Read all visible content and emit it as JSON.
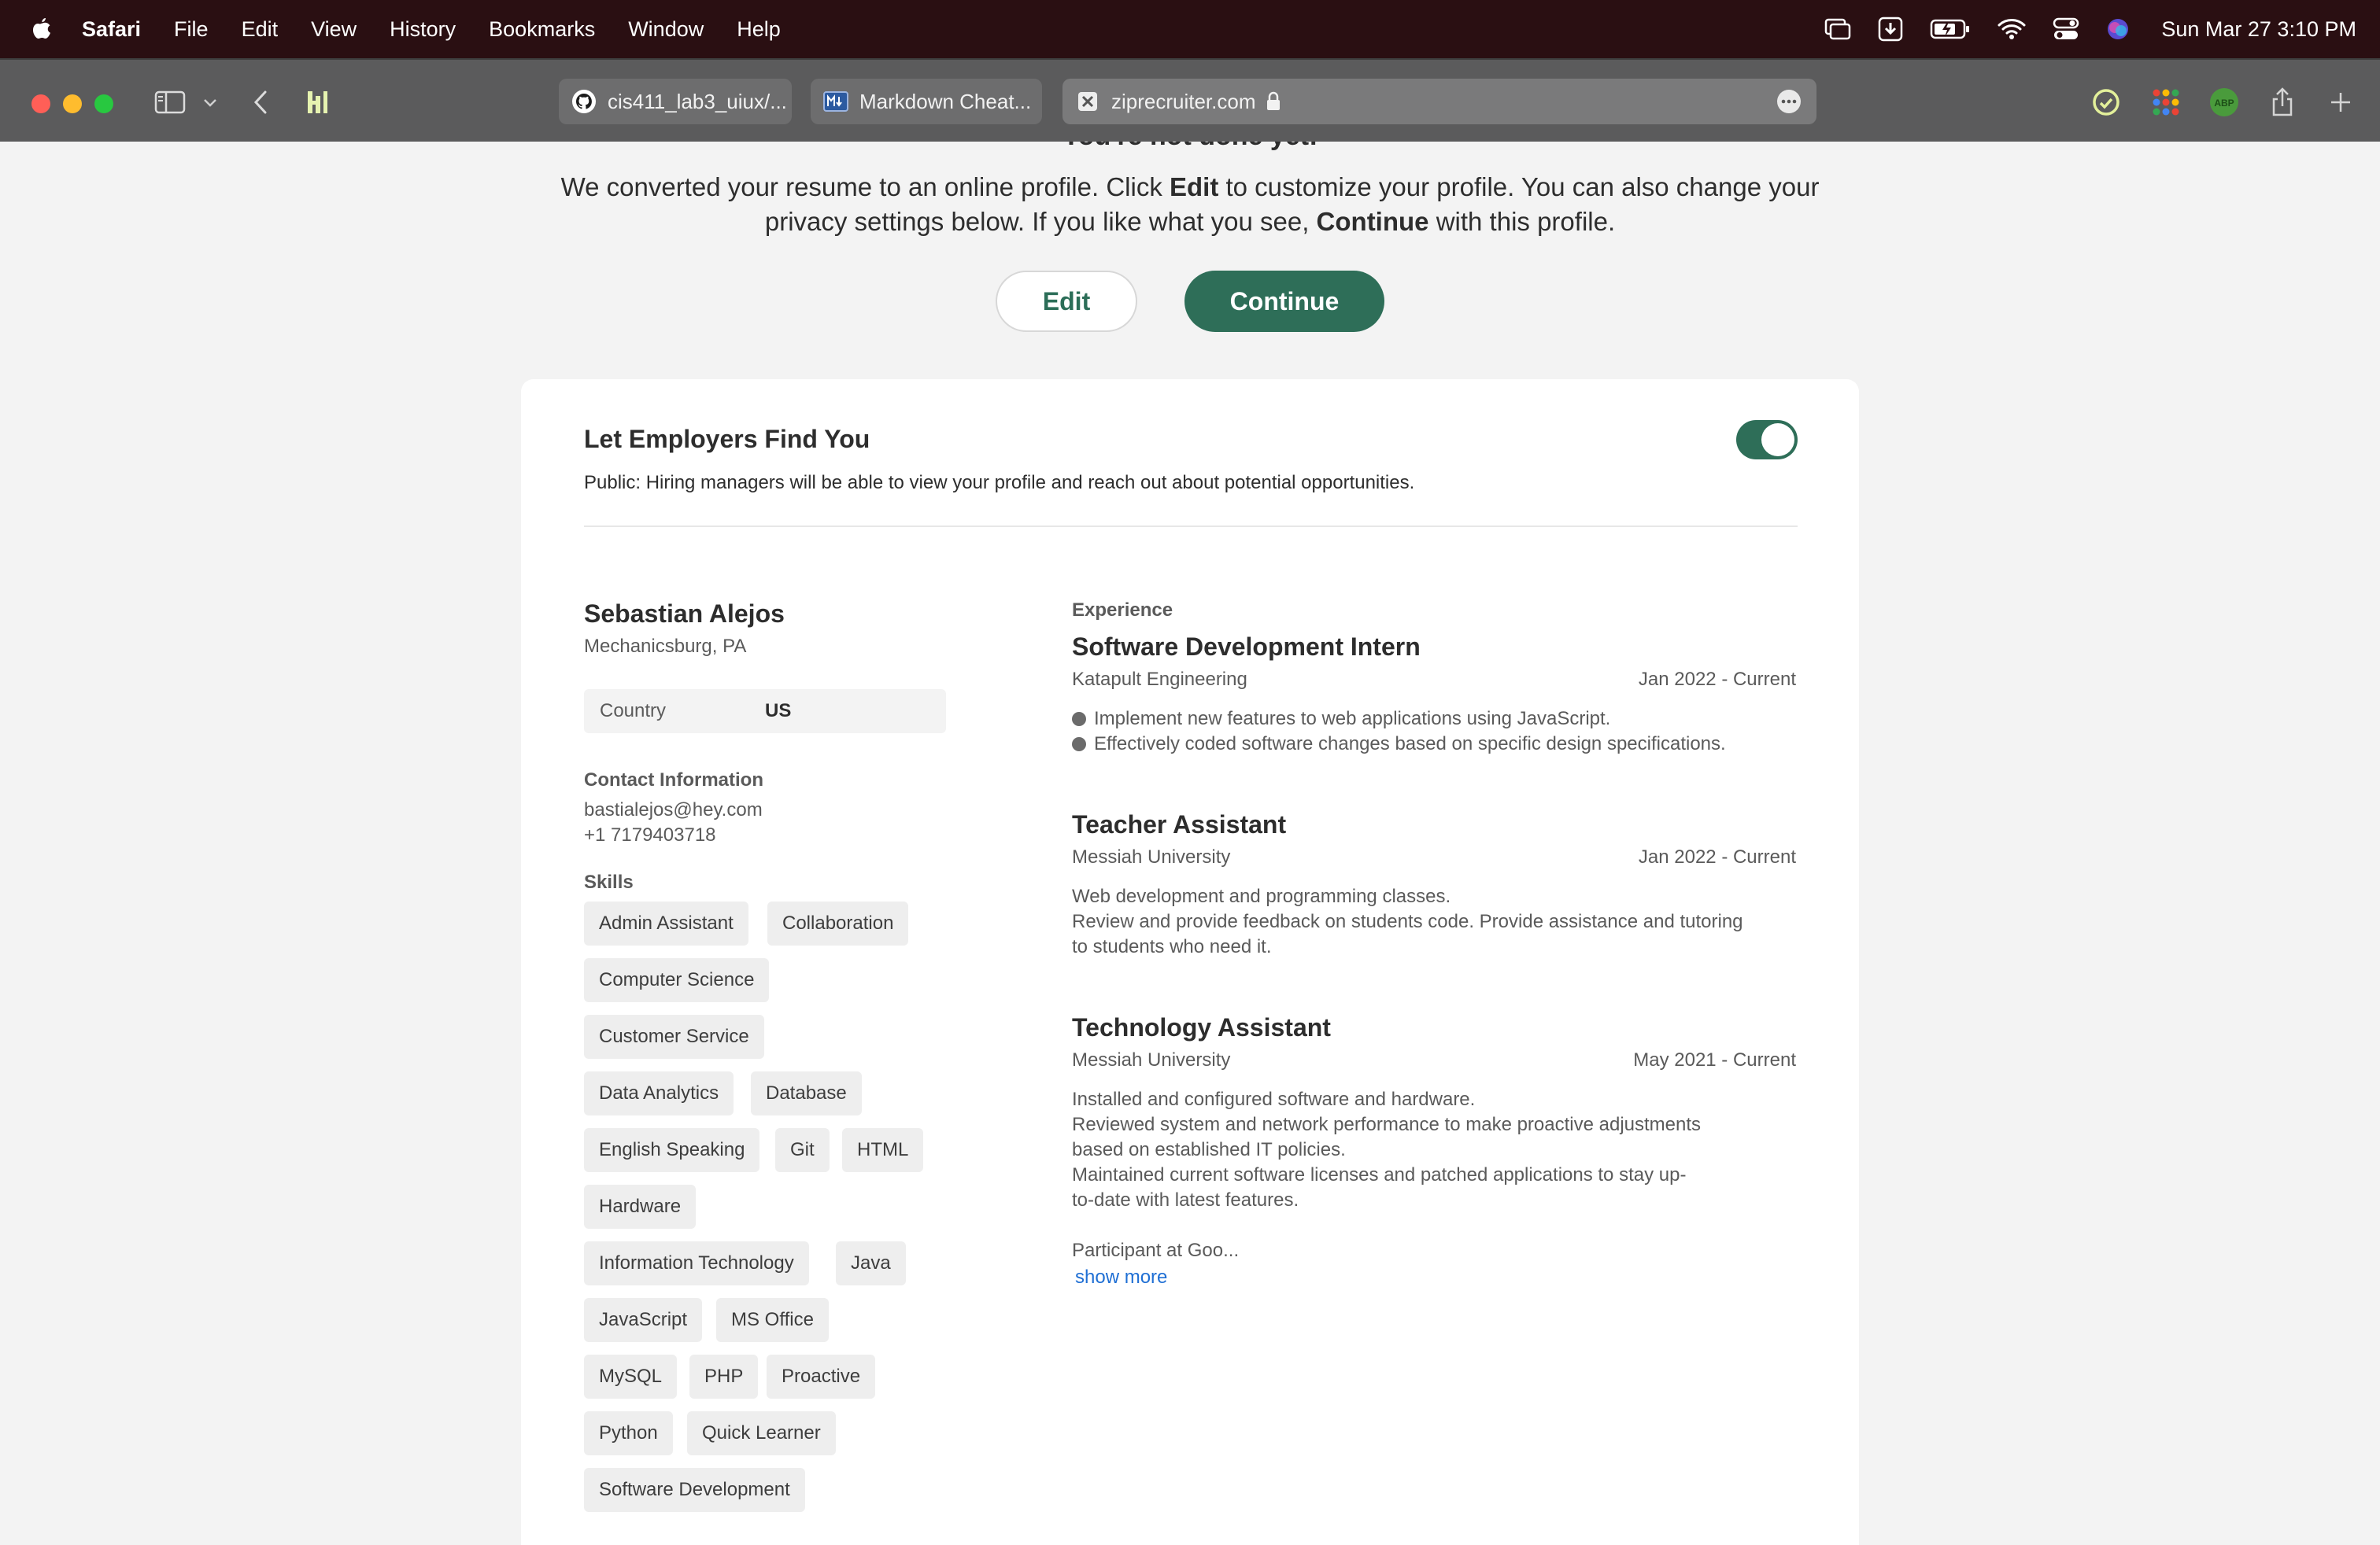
{
  "menubar": {
    "app": "Safari",
    "items": [
      "File",
      "Edit",
      "View",
      "History",
      "Bookmarks",
      "Window",
      "Help"
    ],
    "clock": "Sun Mar 27  3:10 PM"
  },
  "tabs": [
    {
      "label": "cis411_lab3_uiux/...",
      "icon": "github-icon"
    },
    {
      "label": "Markdown Cheat...",
      "icon": "markdown-icon"
    },
    {
      "label": "ziprecruiter.com",
      "icon": "ziprecruiter-icon"
    }
  ],
  "header": {
    "heading": "You're not done yet!",
    "intro_part1": "We converted your resume to an online profile. Click ",
    "intro_edit": "Edit",
    "intro_part2": " to customize your profile. You can also change your privacy settings below. If you like what you see, ",
    "intro_continue": "Continue",
    "intro_part3": " with this profile.",
    "edit_button": "Edit",
    "continue_button": "Continue"
  },
  "visibility": {
    "title": "Let Employers Find You",
    "description": "Public: Hiring managers will be able to view your profile and reach out about potential opportunities.",
    "enabled": true
  },
  "profile": {
    "name": "Sebastian Alejos",
    "location": "Mechanicsburg, PA",
    "country_label": "Country",
    "country_value": "US",
    "contact_label": "Contact Information",
    "email": "bastialejos@hey.com",
    "phone": "+1 7179403718",
    "skills_label": "Skills",
    "skills": [
      "Admin Assistant",
      "Collaboration",
      "Computer Science",
      "Customer Service",
      "Data Analytics",
      "Database",
      "English Speaking",
      "Git",
      "HTML",
      "Hardware",
      "Information Technology",
      "Java",
      "JavaScript",
      "MS Office",
      "MySQL",
      "PHP",
      "Proactive",
      "Python",
      "Quick Learner",
      "Software Development"
    ]
  },
  "experience": {
    "label": "Experience",
    "jobs": [
      {
        "title": "Software Development Intern",
        "company": "Katapult Engineering",
        "dates": "Jan 2022 - Current",
        "lines": [
          "Implement new features to web applications using JavaScript.",
          "Effectively coded software changes based on specific design specifications."
        ]
      },
      {
        "title": "Teacher Assistant",
        "company": "Messiah University",
        "dates": "Jan 2022 - Current",
        "lines": [
          "Web development and programming classes.",
          "Review and provide feedback on students code. Provide assistance and tutoring",
          "to students who need it."
        ]
      },
      {
        "title": "Technology Assistant",
        "company": "Messiah University",
        "dates": "May 2021 - Current",
        "lines": [
          "Installed and configured software and hardware.",
          "Reviewed system and network performance to make proactive adjustments",
          "based on established IT policies.",
          "Maintained current software licenses and patched applications to stay up-",
          "to-date with latest features.",
          "",
          "Participant at Goo..."
        ]
      }
    ],
    "show_more": "show more"
  },
  "colors": {
    "brand_green": "#2e6e58",
    "link_blue": "#1f6fd4",
    "menubar": "#2a0f12",
    "toolbar": "#5b5b5c"
  }
}
